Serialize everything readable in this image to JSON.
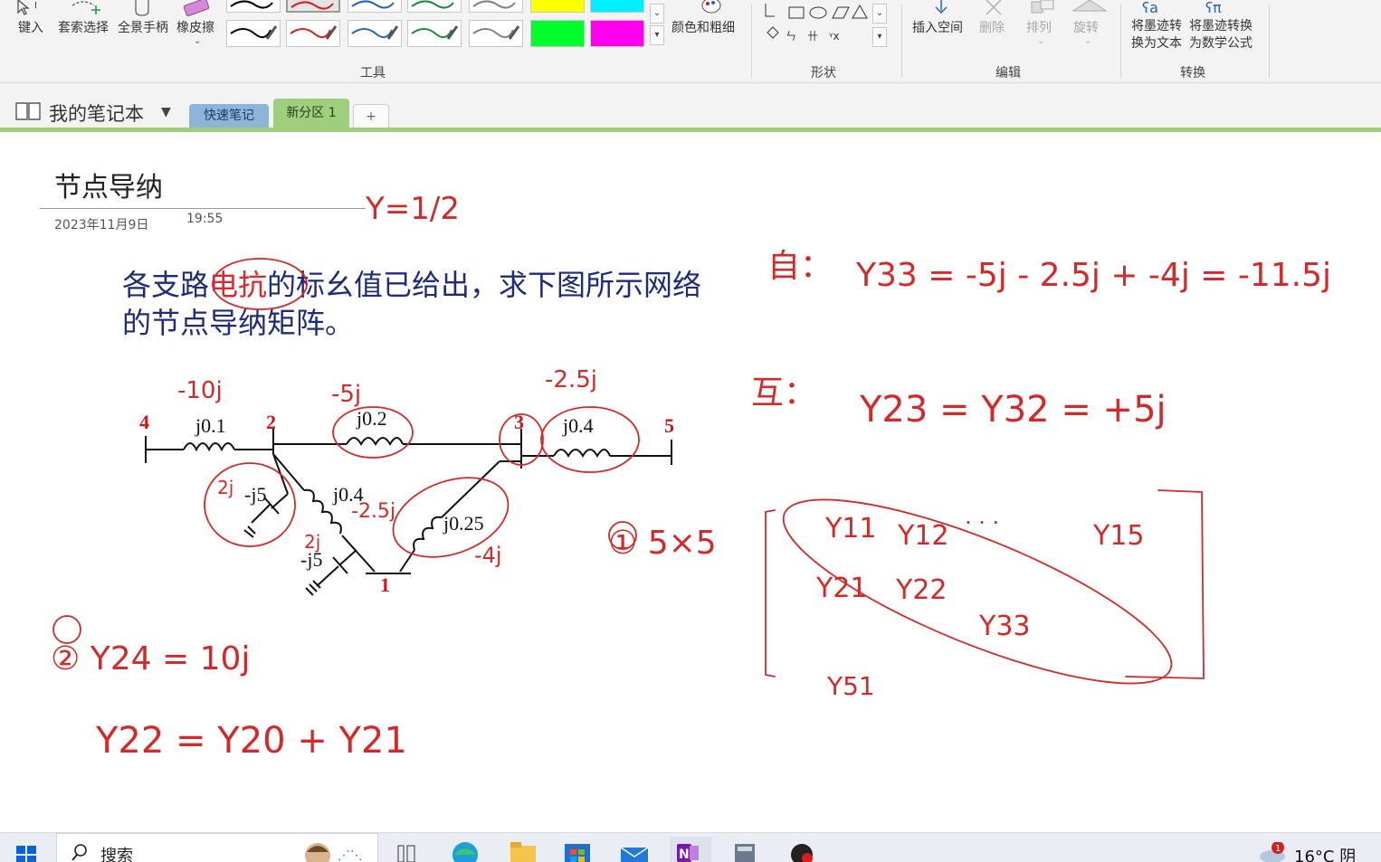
{
  "ribbon": {
    "buttons": {
      "type": "键入",
      "lasso": "套索选择",
      "pan": "全景手柄",
      "eraser": "橡皮擦",
      "color_thickness": "颜色和粗细",
      "insert_space": "插入空间",
      "delete": "删除",
      "arrange": "排列",
      "rotate": "旋转",
      "ink_to_text_l1": "将墨迹转",
      "ink_to_text_l2": "换为文本",
      "ink_to_math_l1": "将墨迹转换",
      "ink_to_math_l2": "为数学公式"
    },
    "groups": {
      "tools": "工具",
      "shapes": "形状",
      "edit": "编辑",
      "convert": "转换"
    },
    "pen_colors": [
      "#000000",
      "#d81e1e",
      "#2a63b5",
      "#1e8a3a",
      "#808080",
      "#00ff2a",
      "#ff00ee"
    ]
  },
  "notebook": {
    "name": "我的笔记本",
    "tabs": [
      "快速笔记",
      "新分区 1",
      "+"
    ]
  },
  "page": {
    "title": "节点导纳",
    "date": "2023年11月9日",
    "time": "19:55",
    "question_a": "各支路",
    "question_red": "电抗",
    "question_b": "的标幺值已给出，求下图所示网络的节点导纳矩阵。",
    "circuit": {
      "nodes": [
        "4",
        "2",
        "3",
        "5",
        "1"
      ],
      "labels": [
        "j0.1",
        "j0.2",
        "j0.4",
        "-j5",
        "j0.4",
        "j0.25",
        "-j5"
      ]
    }
  },
  "handwriting": {
    "y_half": "Y=1/2",
    "self_label": "自：",
    "y33": "Y33 = -5j - 2.5j + -4j = -11.5j",
    "mutual_label": "互：",
    "y23": "Y23 = Y32 = +5j",
    "size": "① 5×5",
    "y24": "② Y24 = 10j",
    "y22": "Y22 = Y20 + Y21",
    "above_j01": "-10j",
    "above_j02": "-5j",
    "above_j04": "-2.5j",
    "near_j04b": "-2.5j",
    "near_j025": "-4j",
    "near_cap1": "2j",
    "near_cap2": "2j",
    "matrix": {
      "row1": [
        "Y11",
        "Y12",
        "· · ·",
        "Y15"
      ],
      "row2": [
        "Y21",
        "Y22"
      ],
      "row3": [
        "Y33"
      ],
      "row_last": [
        "Y51"
      ]
    }
  },
  "taskbar": {
    "search": "搜索",
    "weather": "16°C  阴",
    "notification_count": "1"
  }
}
